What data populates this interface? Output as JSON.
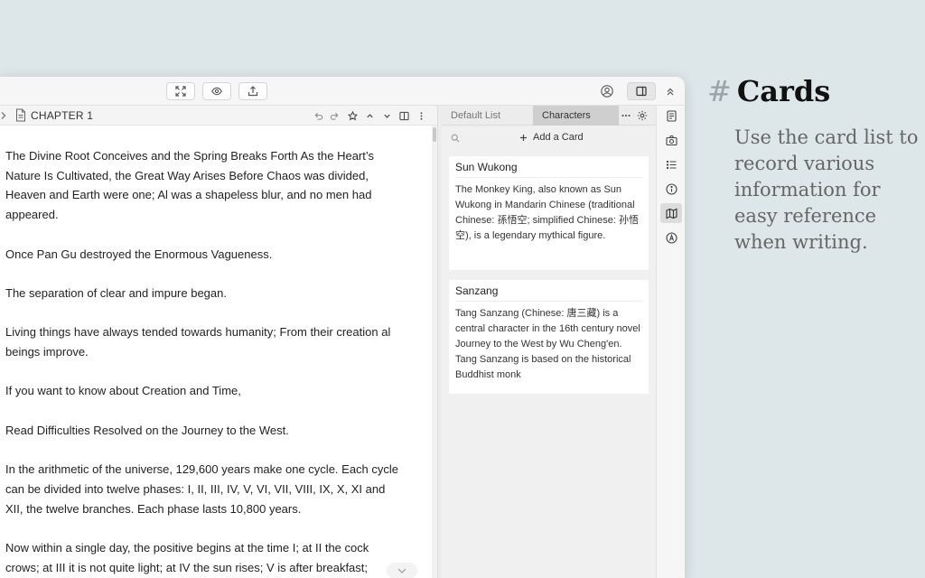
{
  "editor": {
    "chapter_title": "CHAPTER 1",
    "paragraphs": [
      "The Divine Root Conceives and the Spring Breaks Forth As the Heart’s Nature Is Cultivated, the Great Way Arises Before Chaos was divided, Heaven and Earth were one; Al was a shapeless blur, and no men had appeared.",
      "Once Pan Gu destroyed the Enormous Vagueness.",
      "The separation of clear and impure began.",
      "Living things have always tended towards humanity; From their creation al beings improve.",
      "If you want to know about Creation and Time,",
      "Read Difficulties Resolved on the Journey to the West.",
      "In the arithmetic of the universe, 129,600 years make one cycle. Each cycle can be divided into twelve phases: I, II, III, IV, V, VI, VII, VIII, IX, X, XI and XII, the twelve branches. Each phase lasts 10,800 years.",
      "Now within a single day, the positive begins at the time I; at II the cock crows; at III it is not quite light; at IV the sun rises; V is after breakfast;"
    ]
  },
  "panel": {
    "tabs": [
      "Default List",
      "Characters"
    ],
    "active_tab": "Characters",
    "add_card_label": "Add a Card",
    "cards": [
      {
        "title": "Sun Wukong",
        "body": "The Monkey King, also known as Sun Wukong in Mandarin Chinese (traditional Chinese: 孫悟空; simplified Chinese: 孙悟空), is a legendary mythical figure."
      },
      {
        "title": "Sanzang",
        "body": "Tang Sanzang (Chinese: 唐三藏) is a central character in the 16th century novel Journey to the West by Wu Cheng'en. Tang Sanzang is based on the historical Buddhist monk"
      }
    ]
  },
  "marketing": {
    "hash": "#",
    "heading": "Cards",
    "blurb": "Use the card list to record various information for easy reference when writing."
  },
  "icons": {
    "toolbar": [
      "fullscreen-icon",
      "eye-icon",
      "share-icon",
      "user-circle-icon",
      "sidebar-toggle-icon",
      "collapse-up-icon"
    ],
    "strip": [
      "notes-icon",
      "camera-icon",
      "outline-icon",
      "info-icon",
      "map-icon",
      "at-icon"
    ]
  },
  "colors": {
    "background": "#dde6e9",
    "active_tab": "#cfcfcf"
  }
}
